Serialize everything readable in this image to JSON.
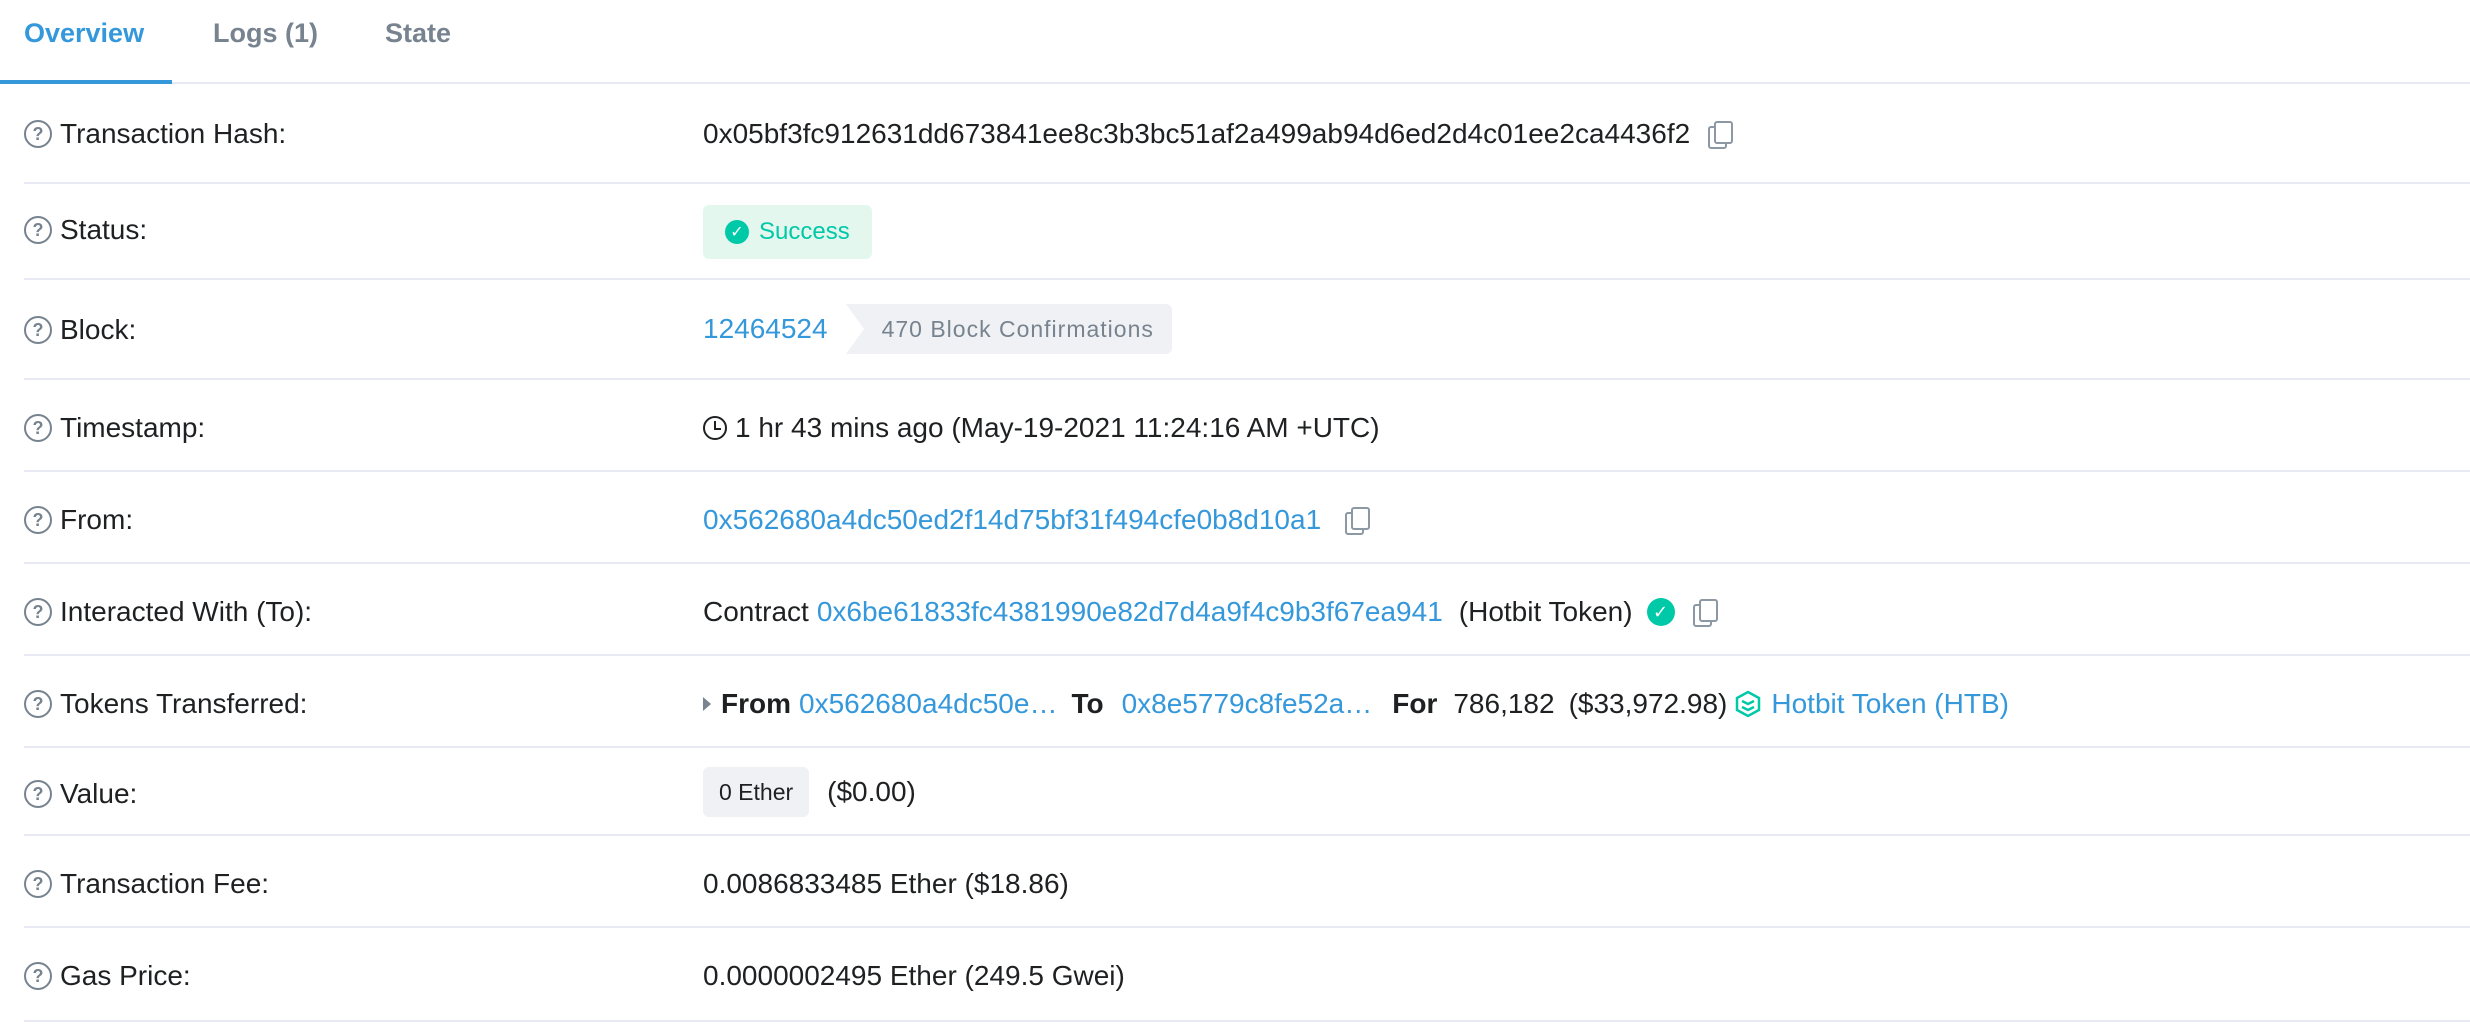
{
  "tabs": [
    {
      "label": "Overview"
    },
    {
      "label": "Logs (1)"
    },
    {
      "label": "State"
    }
  ],
  "help_glyph": "?",
  "rows": {
    "hash": {
      "label": "Transaction Hash:",
      "value": "0x05bf3fc912631dd673841ee8c3b3bc51af2a499ab94d6ed2d4c01ee2ca4436f2"
    },
    "status": {
      "label": "Status:",
      "value": "Success"
    },
    "block": {
      "label": "Block:",
      "number": "12464524",
      "confirmations": "470 Block Confirmations"
    },
    "timestamp": {
      "label": "Timestamp:",
      "value": "1 hr 43 mins ago (May-19-2021 11:24:16 AM +UTC)"
    },
    "from": {
      "label": "From:",
      "address": "0x562680a4dc50ed2f14d75bf31f494cfe0b8d10a1"
    },
    "to": {
      "label": "Interacted With (To):",
      "prefix": "Contract",
      "address": "0x6be61833fc4381990e82d7d4a9f4c9b3f67ea941",
      "name": "(Hotbit Token)"
    },
    "tokens": {
      "label": "Tokens Transferred:",
      "from_label": "From",
      "from_address": "0x562680a4dc50e…",
      "to_label": "To",
      "to_address": "0x8e5779c8fe52a…",
      "for_label": "For",
      "amount": "786,182",
      "usd": "($33,972.98)",
      "token": "Hotbit Token (HTB)"
    },
    "value": {
      "label": "Value:",
      "ether": "0 Ether",
      "usd": "($0.00)"
    },
    "fee": {
      "label": "Transaction Fee:",
      "value": "0.0086833485 Ether ($18.86)"
    },
    "gas": {
      "label": "Gas Price:",
      "value": "0.0000002495 Ether (249.5 Gwei)"
    }
  },
  "colors": {
    "link": "#3498db",
    "success": "#00c9a7",
    "muted": "#77838f",
    "border": "#e7eaf3"
  }
}
